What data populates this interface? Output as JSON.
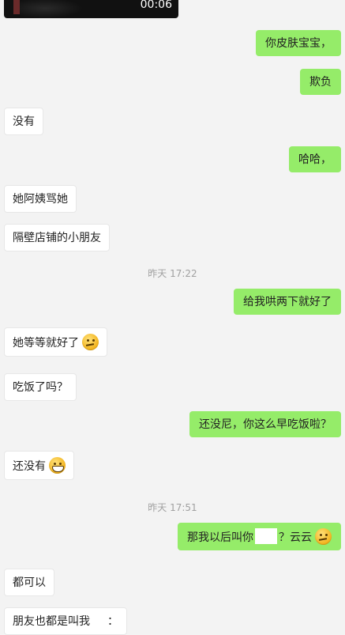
{
  "video": {
    "duration": "00:06"
  },
  "messages": [
    {
      "side": "right",
      "text": "你皮肤宝宝，"
    },
    {
      "side": "right",
      "text": "欺负"
    },
    {
      "side": "left",
      "text": "没有"
    },
    {
      "side": "right",
      "text": "哈哈，"
    },
    {
      "side": "left",
      "text": "她阿姨骂她"
    },
    {
      "side": "left",
      "text": "隔壁店铺的小朋友"
    },
    {
      "type": "time",
      "text": "昨天 17:22"
    },
    {
      "side": "right",
      "text": "给我哄两下就好了"
    },
    {
      "side": "left",
      "text": "她等等就好了",
      "emoji": "thinking-face-icon"
    },
    {
      "side": "left",
      "text": "吃饭了吗？"
    },
    {
      "side": "right",
      "text": "还没尼，你这么早吃饭啦？"
    },
    {
      "side": "left",
      "text": "还没有",
      "emoji": "grinning-face-icon"
    },
    {
      "type": "time",
      "text": "昨天 17:51"
    },
    {
      "side": "right",
      "text_before": "那我以后叫你",
      "text_after": "？云云",
      "emoji": "thinking-face-icon"
    },
    {
      "side": "left",
      "text": "都可以"
    },
    {
      "side": "left",
      "text_before": "朋友也都是叫我",
      "text_after": "："
    }
  ]
}
